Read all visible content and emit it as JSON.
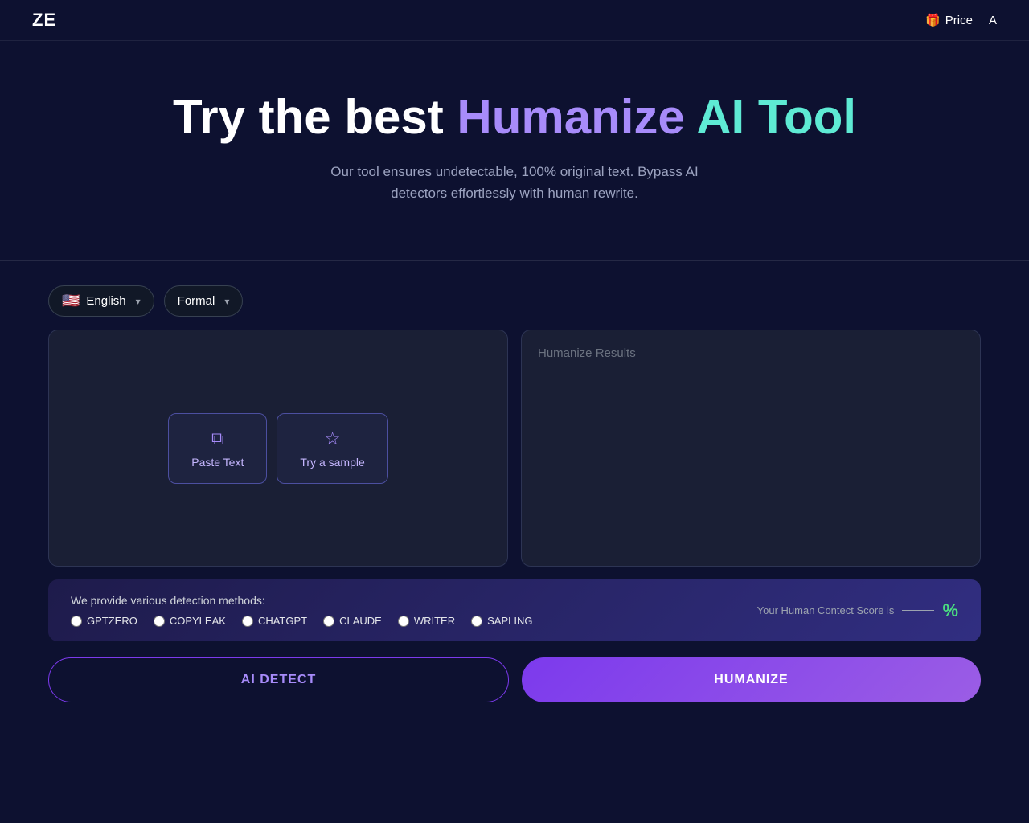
{
  "navbar": {
    "logo": "ZE",
    "price_icon": "🎁",
    "price_label": "Price",
    "api_label": "A"
  },
  "hero": {
    "title_white": "Try the best ",
    "title_purple": "Humanize ",
    "title_teal": "AI Tool",
    "subtitle_line1": "Our tool ensures undetectable, 100% original text. Bypass AI",
    "subtitle_line2": "detectors effortlessly with human rewrite."
  },
  "selectors": {
    "language_flag": "🇺🇸",
    "language_label": "English",
    "tone_label": "Formal"
  },
  "editor": {
    "paste_btn_icon": "⧉",
    "paste_btn_label": "Paste Text",
    "sample_btn_icon": "☆",
    "sample_btn_label": "Try a sample",
    "results_placeholder": "Humanize Results"
  },
  "detection": {
    "label": "We provide various detection methods:",
    "options": [
      "GPTZERO",
      "COPYLEAK",
      "CHATGPT",
      "CLAUDE",
      "WRITER",
      "SAPLING"
    ],
    "score_text": "Your Human Contect Score is",
    "score_value": "%"
  },
  "buttons": {
    "ai_detect": "AI DETECT",
    "humanize": "HUMANIZE"
  }
}
